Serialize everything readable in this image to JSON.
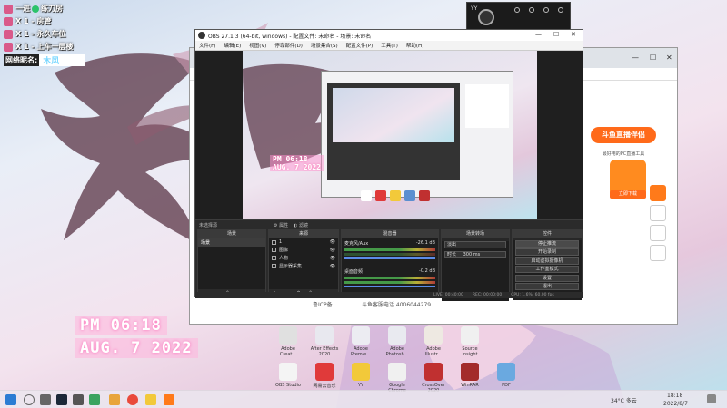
{
  "overlay": {
    "rows": [
      {
        "prefix": "一进",
        "suffix": "练刀房",
        "icon": "pink-badge-icon"
      },
      {
        "text": "X 1 - 房管",
        "icon": "pink-badge-icon"
      },
      {
        "text": "X 1 - 永久车位",
        "icon": "pink-badge-icon"
      },
      {
        "text": "X 1 - 上车一层楼",
        "icon": "pink-badge-icon"
      }
    ],
    "name_label": "网络昵名:",
    "name_value": "木风"
  },
  "clock": {
    "time": "PM 06:18",
    "date": "AUG. 7 2022"
  },
  "widget": {
    "title": "YY"
  },
  "obs": {
    "title": "OBS 27.1.3 (64-bit, windows) - 配置文件: 未命名 - 场景: 未命名",
    "menus": [
      "文件(F)",
      "编辑(E)",
      "视图(V)",
      "停靠部件(D)",
      "场景集合(S)",
      "配置文件(P)",
      "工具(T)",
      "帮助(H)"
    ],
    "preview_clock": {
      "time": "PM 06:18",
      "date": "AUG. 7 2022"
    },
    "no_source": "未选择源",
    "toolbar_props": "属性",
    "toolbar_filters": "滤镜",
    "docks": {
      "scenes": {
        "title": "场景",
        "items": [
          "场景"
        ]
      },
      "sources": {
        "title": "来源",
        "items": [
          "1",
          "图像",
          "人物",
          "显示器采集"
        ]
      },
      "mixer": {
        "title": "混音器",
        "channels": [
          {
            "name": "麦克风/Aux",
            "level": "-26.1 dB"
          },
          {
            "name": "桌面音频",
            "level": "-0.2 dB"
          }
        ]
      },
      "transitions": {
        "title": "场景转场",
        "type": "淡出",
        "duration_label": "时长",
        "duration_value": "300 ms"
      },
      "controls": {
        "title": "控件",
        "buttons": [
          "停止推流",
          "开始录制",
          "启动虚拟摄像机",
          "工作室模式",
          "设置",
          "退出"
        ]
      }
    },
    "status": {
      "live": "LIVE: 00:40:00",
      "rec": "REC: 00:00:00",
      "cpu": "CPU: 1.6%, 60.00 fps"
    }
  },
  "chrome": {
    "douyu_title": "斗鱼直播伴侣",
    "douyu_sub": "最好用的PC直播工具",
    "douyu_btn": "立即下载",
    "footer_prefix": "鲁ICP备",
    "footer": "斗鱼客服电话 4006044279"
  },
  "desktop_icons": [
    {
      "label": "Adobe Creat...",
      "color": "#e0e0e0"
    },
    {
      "label": "After Effects 2020",
      "color": "#e8e8ef"
    },
    {
      "label": "Adobe Premie...",
      "color": "#ececf2"
    },
    {
      "label": "Adobe Photosh...",
      "color": "#e9eaf0"
    },
    {
      "label": "Adobe Illustr...",
      "color": "#eee9e2"
    },
    {
      "label": "Source Insight",
      "color": "#f0f0f0"
    },
    {
      "label": "OBS Studio",
      "color": "#f4f4f4"
    },
    {
      "label": "网易云音乐",
      "color": "#e03a3a"
    },
    {
      "label": "YY",
      "color": "#f2c93a"
    },
    {
      "label": "Google Chrome",
      "color": "#f0f0f0"
    },
    {
      "label": "CrossOver 2020",
      "color": "#c03030"
    },
    {
      "label": "WinRAR",
      "color": "#a32b2b"
    },
    {
      "label": "PDF",
      "color": "#6aa9e0"
    }
  ],
  "taskbar": {
    "weather": "34°C 多云",
    "time": "18:18",
    "date": "2022/8/7"
  }
}
